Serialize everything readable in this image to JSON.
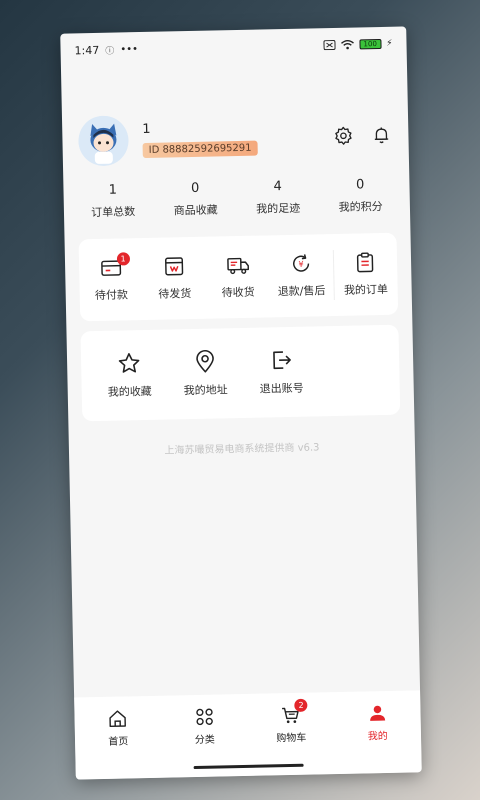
{
  "statusbar": {
    "time": "1:47",
    "battery": "100"
  },
  "profile": {
    "username": "1",
    "id_text": "ID 88882592695291"
  },
  "stats": [
    {
      "value": "1",
      "label": "订单总数"
    },
    {
      "value": "0",
      "label": "商品收藏"
    },
    {
      "value": "4",
      "label": "我的足迹"
    },
    {
      "value": "0",
      "label": "我的积分"
    }
  ],
  "orders": {
    "items": [
      {
        "label": "待付款",
        "badge": "1",
        "icon": "wallet-icon"
      },
      {
        "label": "待发货",
        "badge": "",
        "icon": "package-icon"
      },
      {
        "label": "待收货",
        "badge": "",
        "icon": "truck-icon"
      },
      {
        "label": "退款/售后",
        "badge": "",
        "icon": "refund-icon"
      }
    ],
    "all_label": "我的订单"
  },
  "tools": [
    {
      "label": "我的收藏",
      "icon": "star-icon"
    },
    {
      "label": "我的地址",
      "icon": "location-pin-icon"
    },
    {
      "label": "退出账号",
      "icon": "logout-icon"
    }
  ],
  "provider_text": "上海苏嘬贸易电商系统提供商 v6.3",
  "tabbar": {
    "items": [
      {
        "label": "首页",
        "icon": "home-icon"
      },
      {
        "label": "分类",
        "icon": "category-icon"
      },
      {
        "label": "购物车",
        "icon": "cart-icon",
        "badge": "2"
      },
      {
        "label": "我的",
        "icon": "user-icon",
        "active": true
      }
    ]
  },
  "colors": {
    "accent": "#e3262b",
    "id_badge": "#f4a87c",
    "background": "#f6f6f6"
  }
}
